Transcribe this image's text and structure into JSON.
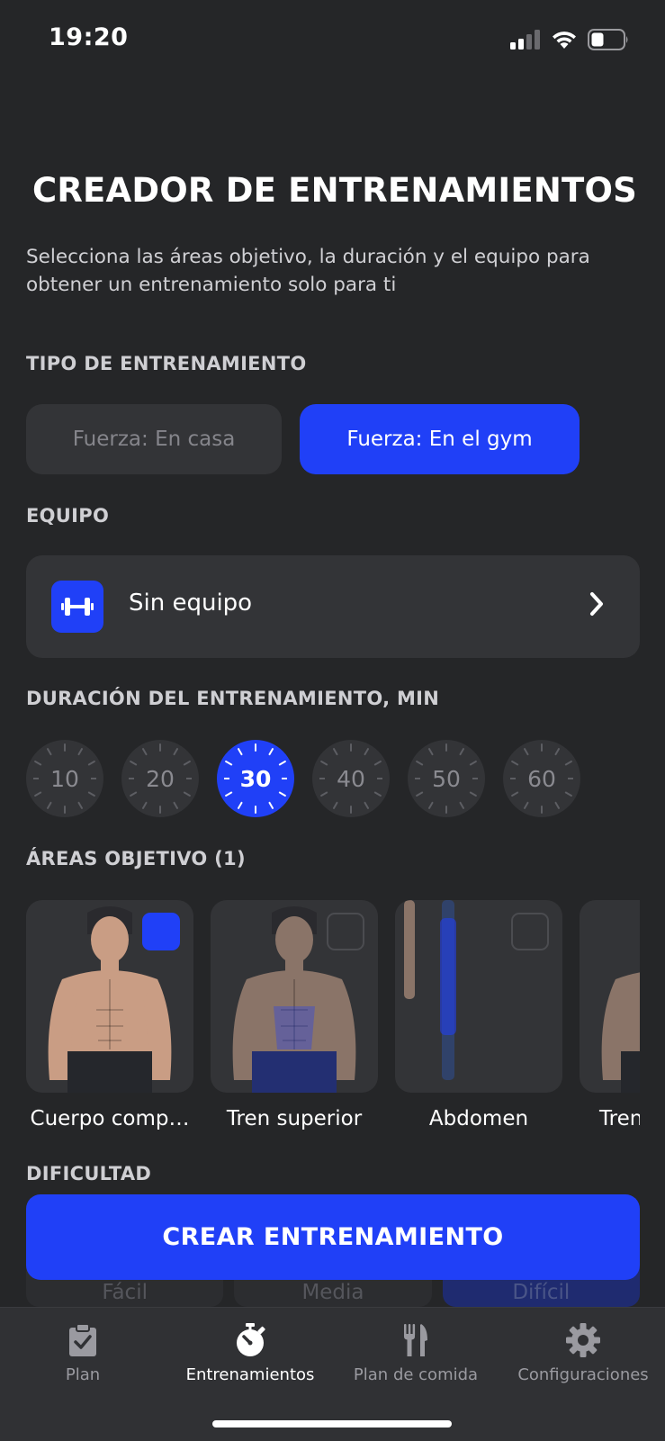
{
  "status_bar": {
    "time": "19:20"
  },
  "header": {
    "title": "CREADOR DE ENTRENAMIENTOS",
    "subtitle": "Selecciona las áreas objetivo, la duración y el equipo para obtener un entrenamiento solo para ti"
  },
  "workout_type": {
    "label": "TIPO DE ENTRENAMIENTO",
    "options": [
      {
        "label": "Fuerza: En casa",
        "selected": false
      },
      {
        "label": "Fuerza: En el gym",
        "selected": true
      }
    ]
  },
  "equipment": {
    "label": "EQUIPO",
    "value": "Sin equipo",
    "icon": "dumbbell-icon"
  },
  "duration": {
    "label": "DURACIÓN DEL ENTRENAMIENTO, MIN",
    "options": [
      "10",
      "20",
      "30",
      "40",
      "50",
      "60"
    ],
    "selected": "30"
  },
  "target_areas": {
    "label": "ÁREAS OBJETIVO (1)",
    "items": [
      {
        "label": "Cuerpo comp…",
        "checked": true
      },
      {
        "label": "Tren superior",
        "checked": false
      },
      {
        "label": "Abdomen",
        "checked": false
      },
      {
        "label": "Tren",
        "checked": false
      }
    ]
  },
  "difficulty": {
    "label": "DIFICULTAD",
    "options": [
      "Fácil",
      "Media",
      "Difícil"
    ],
    "selected": "Difícil"
  },
  "create_button": {
    "label": "CREAR ENTRENAMIENTO"
  },
  "colors": {
    "accent": "#2040f7",
    "background": "#252628",
    "card": "#333437"
  },
  "tab_bar": {
    "items": [
      {
        "label": "Plan",
        "icon": "clipboard-check-icon",
        "active": false
      },
      {
        "label": "Entrenamientos",
        "icon": "stopwatch-icon",
        "active": true
      },
      {
        "label": "Plan de comida",
        "icon": "fork-knife-icon",
        "active": false
      },
      {
        "label": "Configuraciones",
        "icon": "gear-icon",
        "active": false
      }
    ]
  }
}
